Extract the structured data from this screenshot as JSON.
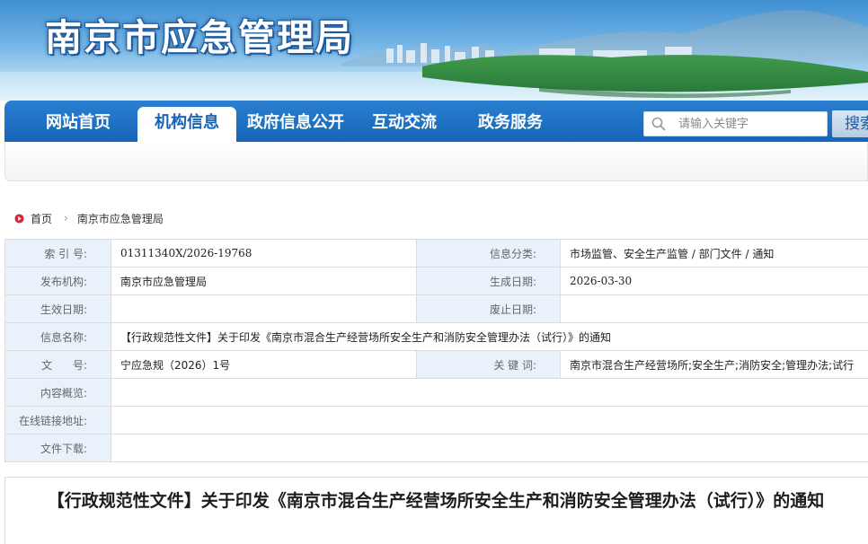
{
  "header": {
    "site_title": "南京市应急管理局"
  },
  "nav": {
    "items": [
      {
        "label": "网站首页",
        "active": false
      },
      {
        "label": "机构信息",
        "active": true
      },
      {
        "label": "政府信息公开",
        "active": false
      },
      {
        "label": "互动交流",
        "active": false
      },
      {
        "label": "政务服务",
        "active": false
      }
    ],
    "search": {
      "placeholder": "请输入关键字",
      "button_label": "搜索"
    }
  },
  "breadcrumb": {
    "home": "首页",
    "current": "南京市应急管理局"
  },
  "info_table": {
    "index_no_label": "索 引 号:",
    "index_no": "01311340X/2026-19768",
    "category_label": "信息分类:",
    "category": "市场监管、安全生产监管 / 部门文件 / 通知",
    "publisher_label": "发布机构:",
    "publisher": "南京市应急管理局",
    "created_label": "生成日期:",
    "created": "2026-03-30",
    "effective_label": "生效日期:",
    "effective": "",
    "expired_label": "废止日期:",
    "expired": "",
    "name_label": "信息名称:",
    "name": "【行政规范性文件】关于印发《南京市混合生产经营场所安全生产和消防安全管理办法（试行）》的通知",
    "doc_no_label": "文      号:",
    "doc_no": "宁应急规（2026）1号",
    "keywords_label": "关 键 词:",
    "keywords": "南京市混合生产经营场所;安全生产;消防安全;管理办法;试行",
    "summary_label": "内容概览:",
    "summary": "",
    "link_label": "在线链接地址:",
    "link": "",
    "download_label": "文件下载:",
    "download": ""
  },
  "article": {
    "title": "【行政规范性文件】关于印发《南京市混合生产经营场所安全生产和消防安全管理办法（试行）》的通知"
  },
  "colors": {
    "nav_blue": "#1565b8",
    "label_bg": "#e9f1fb",
    "banner_sky": "#74b6e6"
  }
}
